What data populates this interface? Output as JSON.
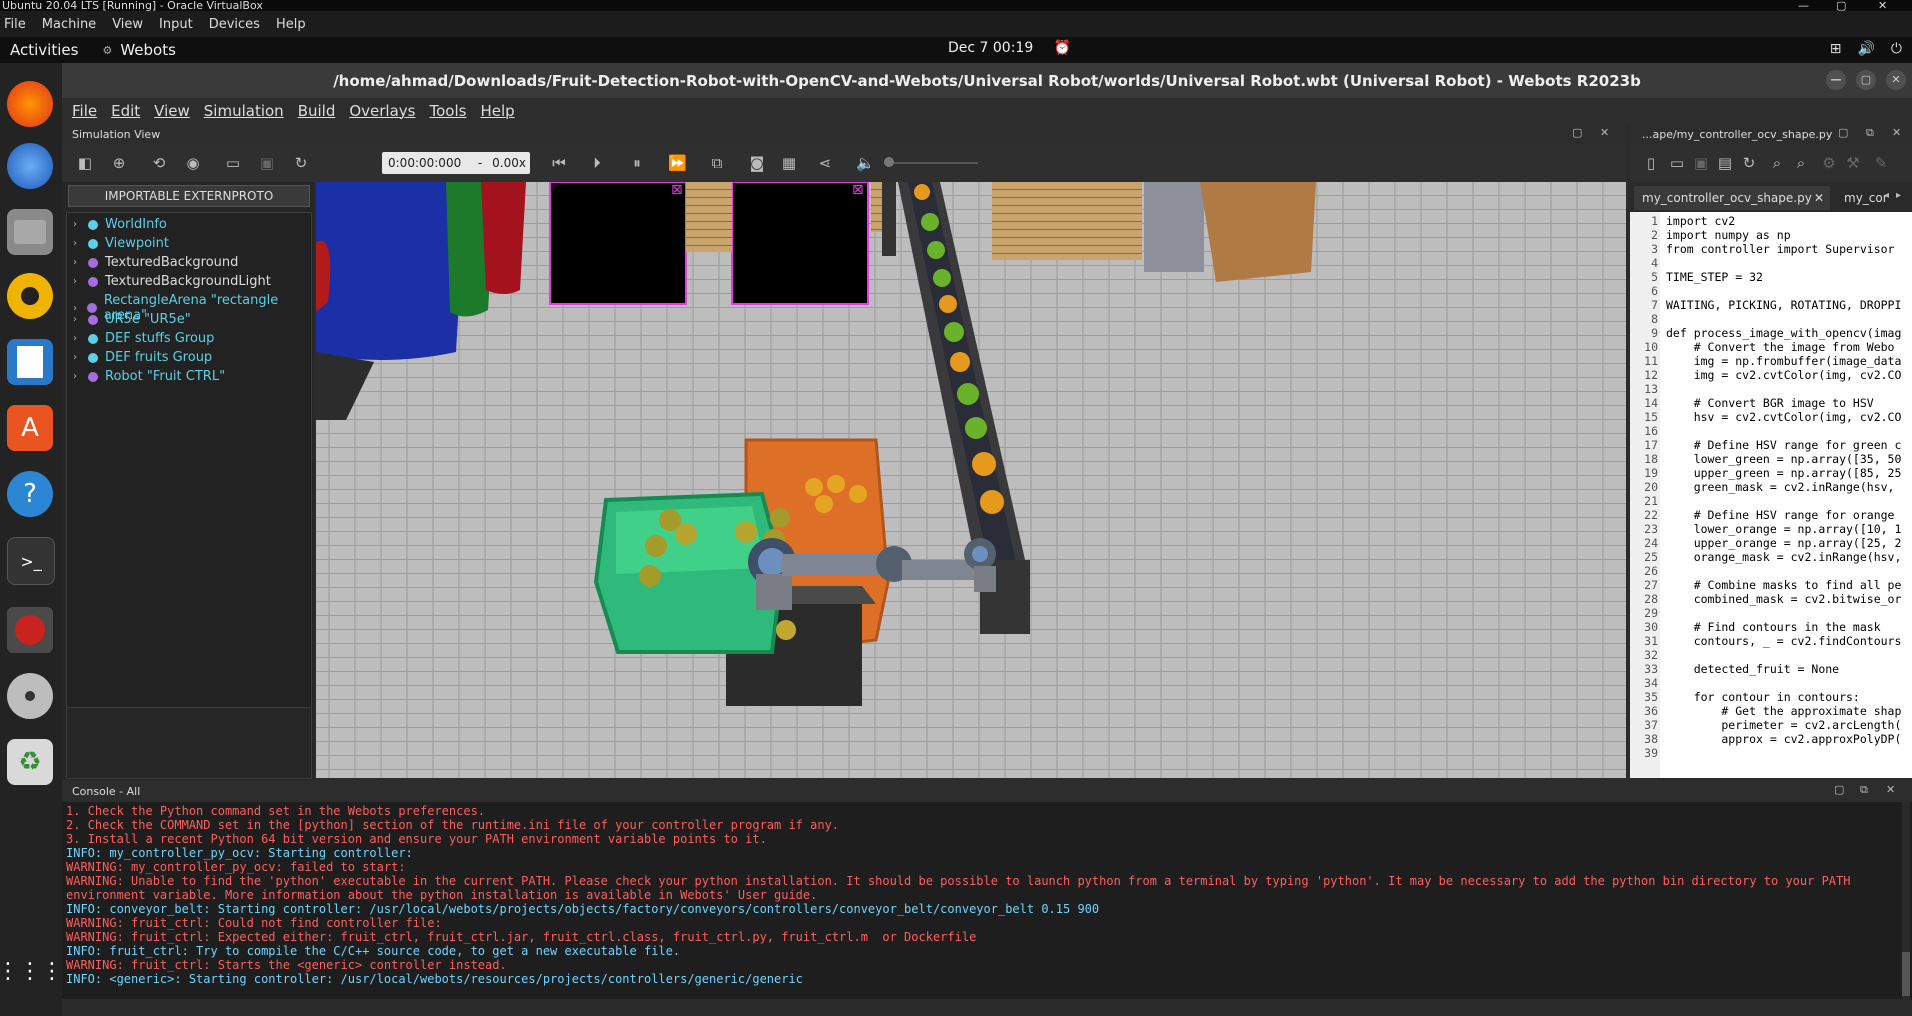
{
  "vbox": {
    "title": "Ubuntu 20.04 LTS [Running] - Oracle VirtualBox",
    "menu": [
      "File",
      "Machine",
      "View",
      "Input",
      "Devices",
      "Help"
    ]
  },
  "gnome": {
    "activities": "Activities",
    "app_name": "Webots",
    "clock": "Dec 7  00:19"
  },
  "webots": {
    "title": "/home/ahmad/Downloads/Fruit-Detection-Robot-with-OpenCV-and-Webots/Universal Robot/worlds/Universal Robot.wbt (Universal Robot) - Webots R2023b",
    "menu": [
      "File",
      "Edit",
      "View",
      "Simulation",
      "Build",
      "Overlays",
      "Tools",
      "Help"
    ],
    "sim_view_label": "Simulation View",
    "time": "0:00:00:000",
    "speed_sep": "-",
    "speed": "0.00x",
    "importable": "IMPORTABLE EXTERNPROTO",
    "tree": [
      {
        "label": "WorldInfo",
        "color": "#5bd0e6",
        "text_color": "#5bd0e6"
      },
      {
        "label": "Viewpoint",
        "color": "#5bd0e6",
        "text_color": "#5bd0e6"
      },
      {
        "label": "TexturedBackground",
        "color": "#a56ee0",
        "text_color": "#dddddd"
      },
      {
        "label": "TexturedBackgroundLight",
        "color": "#a56ee0",
        "text_color": "#dddddd"
      },
      {
        "label": "RectangleArena \"rectangle arena\"",
        "color": "#a56ee0",
        "text_color": "#5bd0e6"
      },
      {
        "label": "UR5e \"UR5e\"",
        "color": "#a56ee0",
        "text_color": "#5bd0e6"
      },
      {
        "label": "DEF stuffs Group",
        "color": "#5bd0e6",
        "text_color": "#5bd0e6"
      },
      {
        "label": "DEF fruits Group",
        "color": "#5bd0e6",
        "text_color": "#5bd0e6"
      },
      {
        "label": "Robot \"Fruit CTRL\"",
        "color": "#a56ee0",
        "text_color": "#5bd0e6"
      }
    ]
  },
  "editor": {
    "header_file": "...ape/my_controller_ocv_shape.py",
    "tab1": "my_controller_ocv_shape.py",
    "tab1_close": "✕",
    "tab2": "my_cor",
    "lines": [
      {
        "n": "1",
        "t": "import cv2"
      },
      {
        "n": "2",
        "t": "import numpy as np"
      },
      {
        "n": "3",
        "t": "from controller import Supervisor"
      },
      {
        "n": "4",
        "t": ""
      },
      {
        "n": "5",
        "t": "TIME_STEP = 32"
      },
      {
        "n": "6",
        "t": ""
      },
      {
        "n": "7",
        "t": "WAITING, PICKING, ROTATING, DROPPI"
      },
      {
        "n": "8",
        "t": ""
      },
      {
        "n": "9",
        "t": "def process_image_with_opencv(imag"
      },
      {
        "n": "10",
        "t": "    # Convert the image from Webo"
      },
      {
        "n": "11",
        "t": "    img = np.frombuffer(image_data"
      },
      {
        "n": "12",
        "t": "    img = cv2.cvtColor(img, cv2.CO"
      },
      {
        "n": "13",
        "t": ""
      },
      {
        "n": "14",
        "t": "    # Convert BGR image to HSV"
      },
      {
        "n": "15",
        "t": "    hsv = cv2.cvtColor(img, cv2.CO"
      },
      {
        "n": "16",
        "t": ""
      },
      {
        "n": "17",
        "t": "    # Define HSV range for green c"
      },
      {
        "n": "18",
        "t": "    lower_green = np.array([35, 50"
      },
      {
        "n": "19",
        "t": "    upper_green = np.array([85, 25"
      },
      {
        "n": "20",
        "t": "    green_mask = cv2.inRange(hsv,"
      },
      {
        "n": "21",
        "t": ""
      },
      {
        "n": "22",
        "t": "    # Define HSV range for orange"
      },
      {
        "n": "23",
        "t": "    lower_orange = np.array([10, 1"
      },
      {
        "n": "24",
        "t": "    upper_orange = np.array([25, 2"
      },
      {
        "n": "25",
        "t": "    orange_mask = cv2.inRange(hsv,"
      },
      {
        "n": "26",
        "t": ""
      },
      {
        "n": "27",
        "t": "    # Combine masks to find all pe"
      },
      {
        "n": "28",
        "t": "    combined_mask = cv2.bitwise_or"
      },
      {
        "n": "29",
        "t": ""
      },
      {
        "n": "30",
        "t": "    # Find contours in the mask"
      },
      {
        "n": "31",
        "t": "    contours, _ = cv2.findContours"
      },
      {
        "n": "32",
        "t": ""
      },
      {
        "n": "33",
        "t": "    detected_fruit = None"
      },
      {
        "n": "34",
        "t": ""
      },
      {
        "n": "35",
        "t": "    for contour in contours:"
      },
      {
        "n": "36",
        "t": "        # Get the approximate shap"
      },
      {
        "n": "37",
        "t": "        perimeter = cv2.arcLength("
      },
      {
        "n": "38",
        "t": "        approx = cv2.approxPolyDP("
      },
      {
        "n": "39",
        "t": ""
      }
    ]
  },
  "console": {
    "title": "Console - All",
    "lines": [
      {
        "t": "1. Check the Python command set in the Webots preferences.",
        "k": "red"
      },
      {
        "t": "2. Check the COMMAND set in the [python] section of the runtime.ini file of your controller program if any.",
        "k": "red"
      },
      {
        "t": "3. Install a recent Python 64 bit version and ensure your PATH environment variable points to it.",
        "k": "red"
      },
      {
        "t": "INFO: my_controller_py_ocv: Starting controller:",
        "k": "cyan"
      },
      {
        "t": "WARNING: my_controller_py_ocv: failed to start:",
        "k": "red"
      },
      {
        "t": "WARNING: Unable to find the 'python' executable in the current PATH. Please check your python installation. It should be possible to launch python from a terminal by typing 'python'. It may be necessary to add the python bin directory to your PATH",
        "k": "red"
      },
      {
        "t": "environment variable. More information about the python installation is available in Webots' User guide.",
        "k": "red"
      },
      {
        "t": "INFO: conveyor_belt: Starting controller: /usr/local/webots/projects/objects/factory/conveyors/controllers/conveyor_belt/conveyor_belt 0.15 900",
        "k": "cyan"
      },
      {
        "t": "WARNING: fruit_ctrl: Could not find controller file:",
        "k": "red"
      },
      {
        "t": "WARNING: fruit_ctrl: Expected either: fruit_ctrl, fruit_ctrl.jar, fruit_ctrl.class, fruit_ctrl.py, fruit_ctrl.m  or Dockerfile",
        "k": "red"
      },
      {
        "t": "INFO: fruit_ctrl: Try to compile the C/C++ source code, to get a new executable file.",
        "k": "cyan"
      },
      {
        "t": "WARNING: fruit_ctrl: Starts the <generic> controller instead.",
        "k": "red"
      },
      {
        "t": "INFO: <generic>: Starting controller: /usr/local/webots/resources/projects/controllers/generic/generic",
        "k": "cyan"
      }
    ]
  }
}
